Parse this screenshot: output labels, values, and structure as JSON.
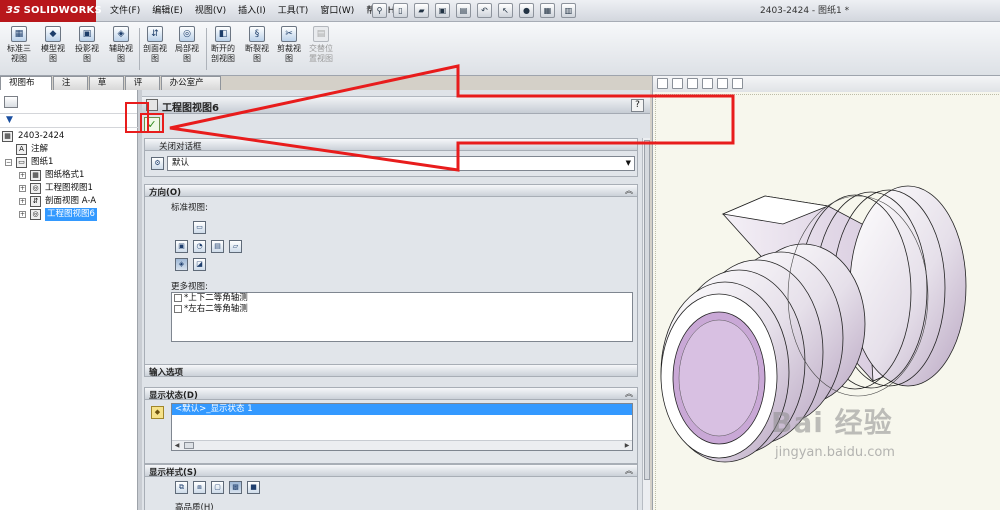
{
  "titlebar": {
    "logo": "SOLIDWORKS",
    "logo_prefix": "3S",
    "document_title": "2403-2424 - 图纸1 *",
    "menus": [
      "文件(F)",
      "编辑(E)",
      "视图(V)",
      "插入(I)",
      "工具(T)",
      "窗口(W)",
      "帮助(H)"
    ]
  },
  "ribbon": {
    "buttons": [
      {
        "label": "标准三\n视图",
        "glyph": "▦",
        "disabled": false
      },
      {
        "label": "模型视\n图",
        "glyph": "◆",
        "disabled": false
      },
      {
        "label": "投影视\n图",
        "glyph": "▣",
        "disabled": false
      },
      {
        "label": "辅助视\n图",
        "glyph": "◈",
        "disabled": false
      },
      {
        "label": "剖面视\n图",
        "glyph": "⇵",
        "disabled": false
      },
      {
        "label": "局部视\n图",
        "glyph": "◎",
        "disabled": false
      },
      {
        "label": "断开的\n剖视图",
        "glyph": "◧",
        "disabled": false
      },
      {
        "label": "断裂视\n图",
        "glyph": "§",
        "disabled": false
      },
      {
        "label": "剪裁视\n图",
        "glyph": "✂",
        "disabled": false
      },
      {
        "label": "交替位\n置视图",
        "glyph": "▤",
        "disabled": true
      }
    ]
  },
  "manager_tabs": [
    {
      "label": "视图布局",
      "active": true
    },
    {
      "label": "注解",
      "active": false
    },
    {
      "label": "草图",
      "active": false
    },
    {
      "label": "评估",
      "active": false
    },
    {
      "label": "办公室产品",
      "active": false
    }
  ],
  "tree": {
    "root": "2403-2424",
    "nodes": [
      {
        "label": "注解",
        "glyph": "A",
        "level": 1,
        "expander": ""
      },
      {
        "label": "图纸1",
        "glyph": "▭",
        "level": 1,
        "expander": "−"
      },
      {
        "label": "图纸格式1",
        "glyph": "▦",
        "level": 2,
        "expander": "+"
      },
      {
        "label": "工程图视图1",
        "glyph": "◎",
        "level": 2,
        "expander": "+"
      },
      {
        "label": "剖面视图 A-A",
        "glyph": "⇵",
        "level": 2,
        "expander": "+"
      },
      {
        "label": "工程图视图6",
        "glyph": "◎",
        "level": 2,
        "expander": "+",
        "selected": true
      }
    ]
  },
  "property_manager": {
    "title": "工程图视图6",
    "help": "?",
    "ok_glyph": "✓",
    "dialog_group": {
      "title": "关闭对话框",
      "dropdown_value": "默认"
    },
    "orientation": {
      "title": "方向(O)",
      "standard_views_label": "标准视图:",
      "more_views_label": "更多视图:",
      "more_views": [
        "*上下二等角轴测",
        "*左右二等角轴测"
      ]
    },
    "import_options": {
      "title": "输入选项"
    },
    "display_state": {
      "title": "显示状态(D)",
      "selected_item": "<默认>_显示状态 1"
    },
    "display_style": {
      "title": "显示样式(S)",
      "partial_label": "高品质(H)"
    }
  },
  "graphics": {
    "watermark_brand": "Bai 经验",
    "watermark_url": "jingyan.baidu.com"
  },
  "colors": {
    "annotation_red": "#e81c1c",
    "selection_blue": "#3399ff",
    "brand_red": "#b8171b"
  }
}
